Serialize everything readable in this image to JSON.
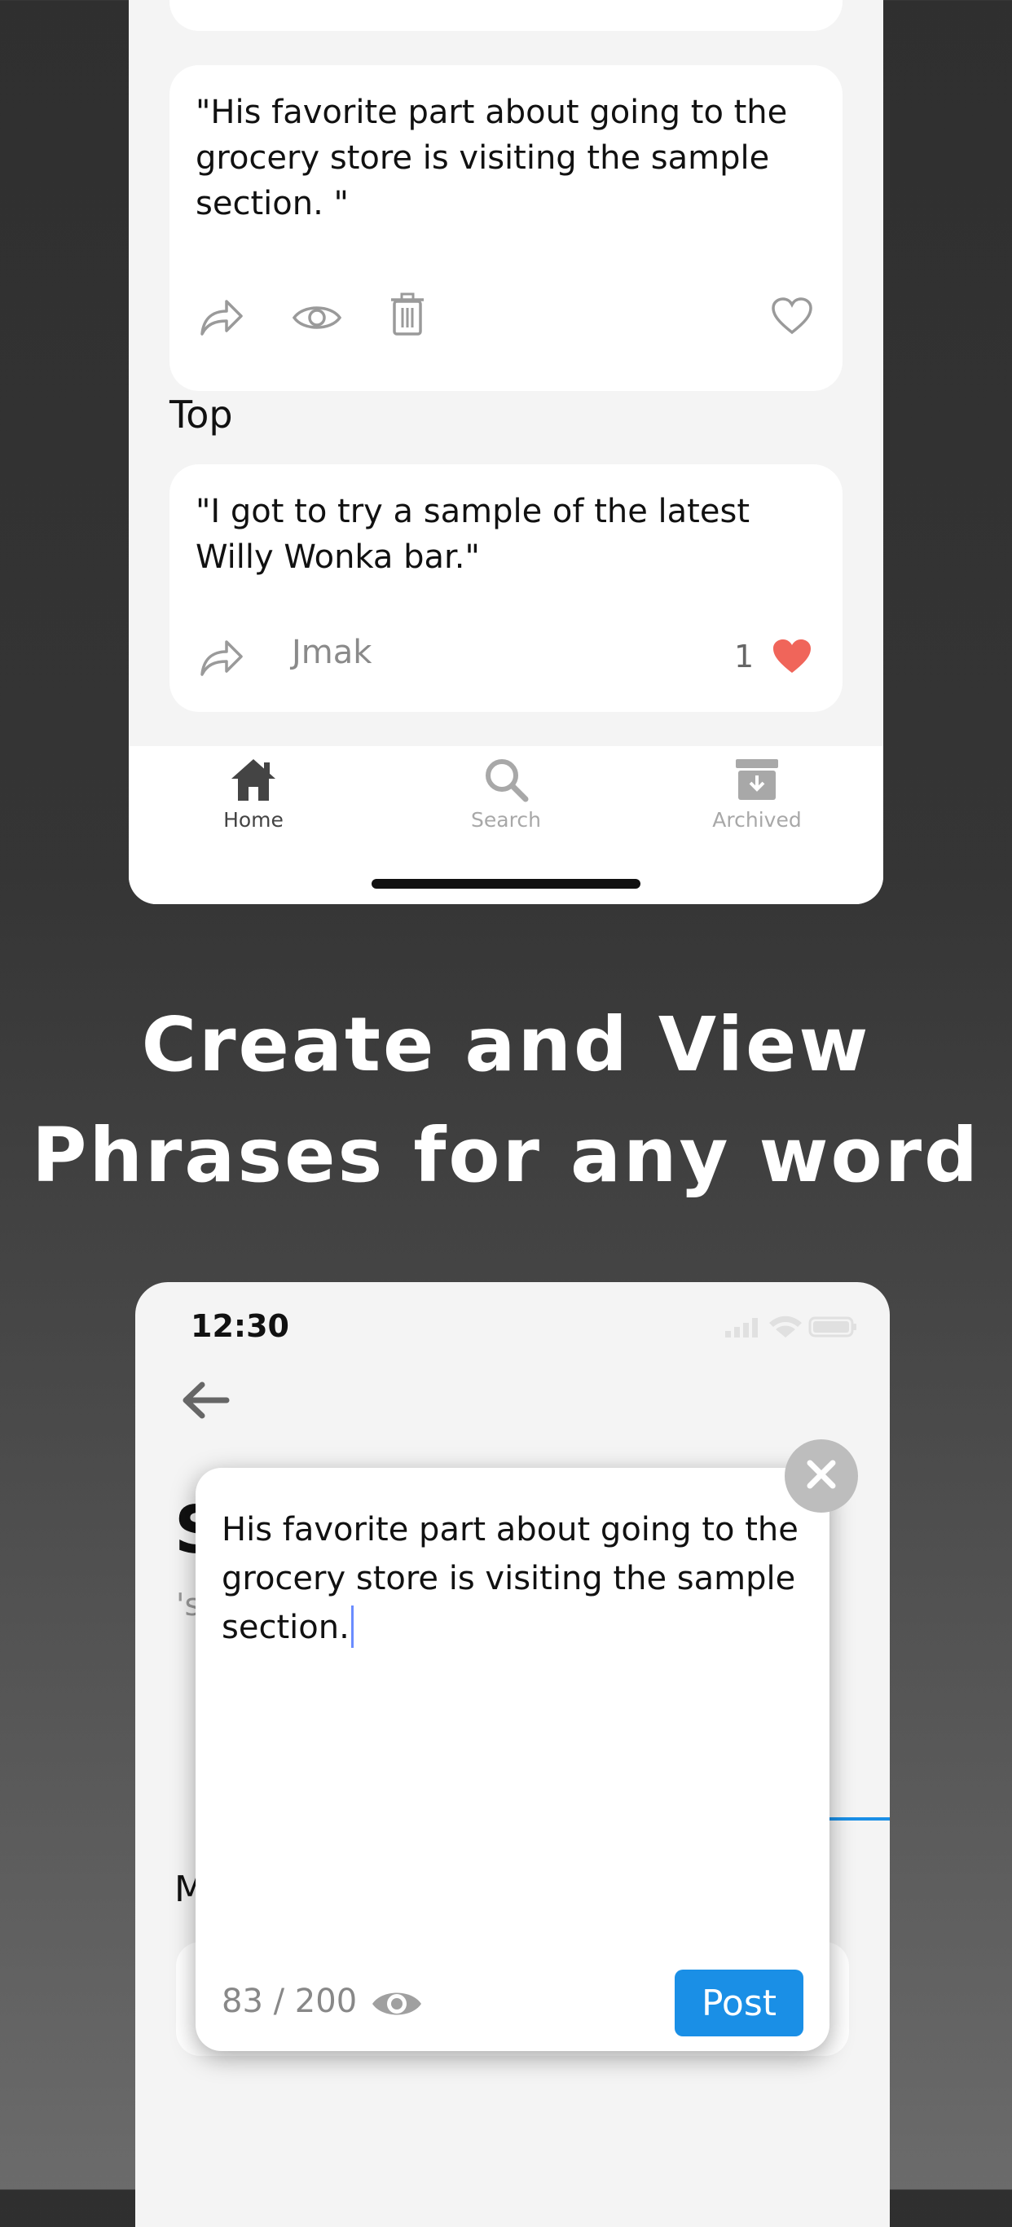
{
  "top_phone": {
    "feed_card_1": {
      "quote": "\"His favorite part about going to the grocery store is visiting the sample section. \"",
      "icons": [
        "share-icon",
        "eye-icon",
        "trash-icon",
        "heart-outline-icon"
      ]
    },
    "section_title": "Top",
    "top_card": {
      "quote": "\"I got to try a sample of the latest Willy Wonka bar.\"",
      "username": "Jmak",
      "like_count": "1",
      "icons": [
        "share-icon",
        "heart-filled-icon"
      ]
    },
    "tabs": [
      {
        "label": "Home",
        "icon": "home-icon",
        "active": true
      },
      {
        "label": "Search",
        "icon": "search-icon",
        "active": false
      },
      {
        "label": "Archived",
        "icon": "archive-icon",
        "active": false
      }
    ]
  },
  "headline": {
    "line1": "Create and View",
    "line2": "Phrases for any word"
  },
  "bottom_phone": {
    "status_time": "12:30",
    "peek_title_letter": "S",
    "peek_quote_char": "'s",
    "peek_section_letter": "M",
    "compose": {
      "text": "His favorite part about going to the grocery store is visiting the sample section.",
      "char_count": "83 / 200",
      "post_label": "Post"
    }
  },
  "colors": {
    "accent_blue": "#1a8fe6",
    "like_red": "#f0655a",
    "tab_active": "#444444",
    "tab_inactive": "#a8a8a8"
  }
}
